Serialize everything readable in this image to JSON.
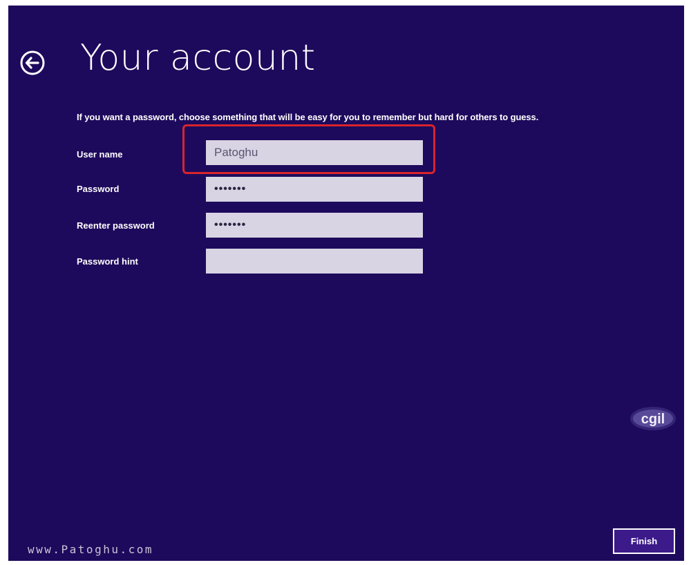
{
  "header": {
    "title": "Your account",
    "back_icon": "back-arrow-icon"
  },
  "form": {
    "instructions": "If you want a password, choose something that will be easy for you to remember but hard for others to guess.",
    "fields": [
      {
        "label": "User name",
        "value": "Patoghu",
        "type": "text"
      },
      {
        "label": "Password",
        "value": "•••••••",
        "type": "password"
      },
      {
        "label": "Reenter password",
        "value": "•••••••",
        "type": "password"
      },
      {
        "label": "Password hint",
        "value": "",
        "type": "text"
      }
    ]
  },
  "footer": {
    "url": "www.Patoghu.com",
    "finish_label": "Finish"
  },
  "watermark": {
    "logo_text": "cgil"
  },
  "colors": {
    "background": "#1e0a5c",
    "input_background": "#d8d4e4",
    "highlight": "#d9242c",
    "button_background": "#3d1a8a"
  }
}
